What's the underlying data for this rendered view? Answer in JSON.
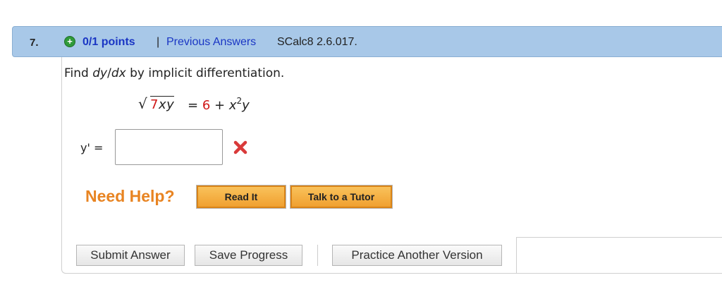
{
  "question": {
    "number": "7.",
    "points": "0/1 points",
    "separator": "|",
    "previous_answers": "Previous Answers",
    "code": "SCalc8 2.6.017."
  },
  "prompt": {
    "prefix": "Find ",
    "dy": "dy",
    "slash": "/",
    "dx": "dx",
    "suffix": " by implicit differentiation."
  },
  "equation": {
    "sqrt_sign": "√",
    "coef": "7",
    "radicand_vars": "xy",
    "equals": "=",
    "constant": "6",
    "plus": "+",
    "x": "x",
    "exponent": "2",
    "y": "y"
  },
  "answer": {
    "label": "y' =",
    "value": "",
    "status": "incorrect",
    "status_color": "#d01818"
  },
  "help": {
    "label": "Need Help?",
    "read_it": "Read It",
    "talk_to_tutor": "Talk to a Tutor"
  },
  "actions": {
    "submit": "Submit Answer",
    "save": "Save Progress",
    "practice": "Practice Another Version"
  },
  "colors": {
    "header_bg": "#a8c8e8",
    "link": "#1a36c4",
    "accent_orange": "#e88422",
    "constant_red": "#d01818"
  }
}
